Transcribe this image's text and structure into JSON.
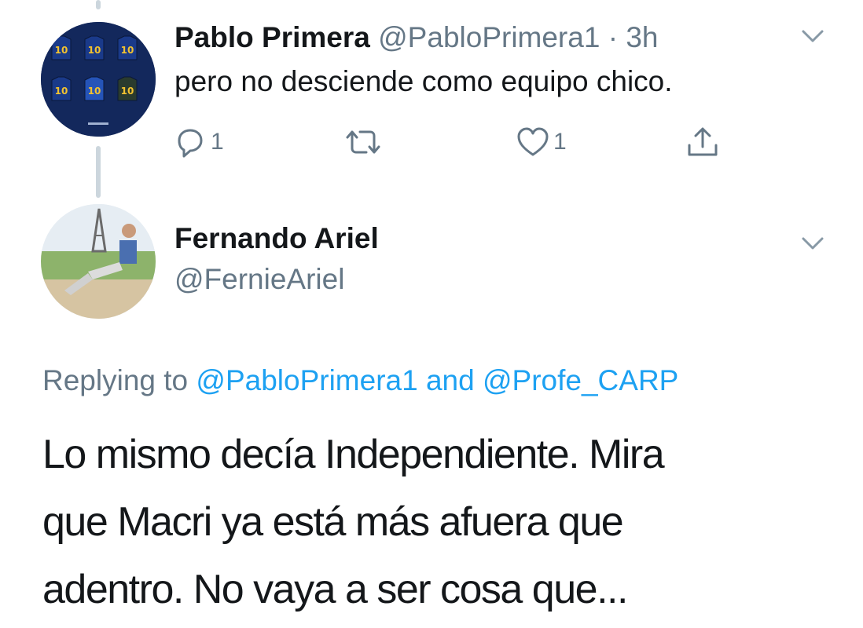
{
  "tweet1": {
    "display_name": "Pablo Primera",
    "handle": "@PabloPrimera1",
    "separator": "·",
    "time": "3h",
    "text": "pero no desciende como equipo chico.",
    "reply_count": "1",
    "like_count": "1",
    "avatar": {
      "jersey_number": "10",
      "description": "team jerseys"
    }
  },
  "tweet2": {
    "display_name": "Fernando Ariel",
    "handle": "@FernieAriel",
    "replying_prefix": "Replying to",
    "replying_user1": "@PabloPrimera1",
    "replying_and": "and",
    "replying_user2": "@Profe_CARP",
    "text_lines": [
      "Lo mismo decía Independiente. Mira",
      "que Macri ya está más afuera que",
      "adentro. No vaya a ser cosa que..."
    ]
  },
  "colors": {
    "text": "#14171a",
    "secondary": "#657786",
    "link": "#1da1f2",
    "thread_line": "#ccd6dd"
  },
  "icons": [
    "chevron-down-icon",
    "reply-icon",
    "retweet-icon",
    "like-icon",
    "share-icon"
  ]
}
